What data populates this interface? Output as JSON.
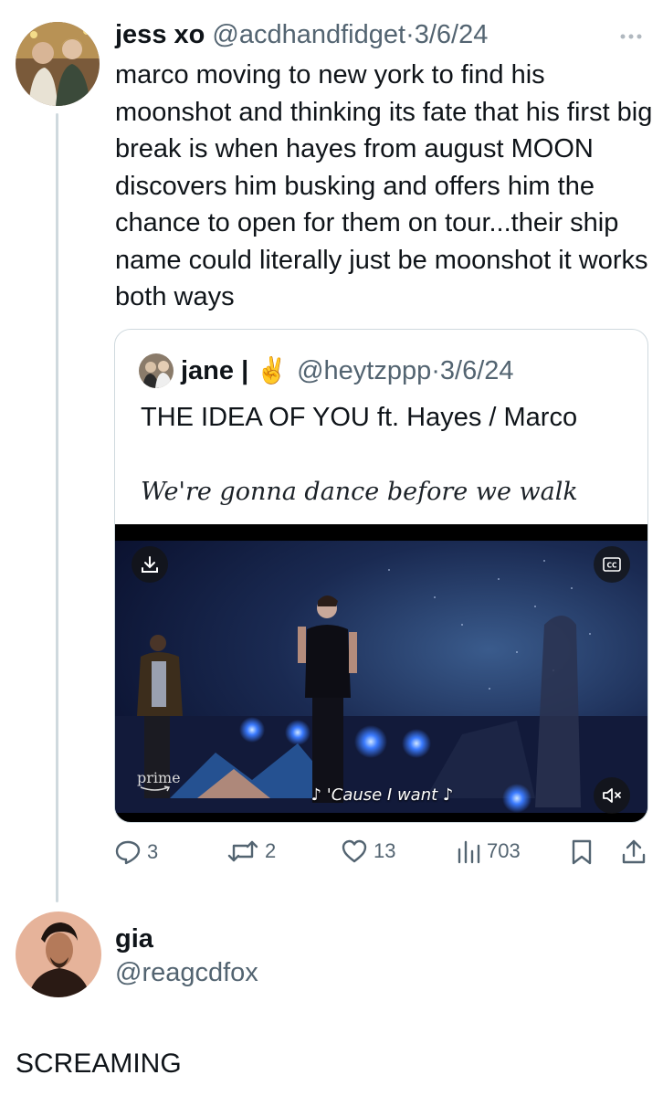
{
  "tweet": {
    "name": "jess xo",
    "handle": "@acdhandfidget",
    "dot": "·",
    "date": "3/6/24",
    "text": "marco moving to new york to find his moonshot and thinking its fate that his first big break is when hayes from august MOON discovers him busking and offers him the chance to open for them on tour...their ship name could literally just be moonshot it works both ways",
    "more_icon": "more-dots-icon"
  },
  "quote": {
    "name": "jane |",
    "emoji": "✌️",
    "handle": "@heytzppp",
    "dot": "·",
    "date": "3/6/24",
    "line1": "THE IDEA OF YOU ft. Hayes / Marco",
    "line2": "We're gonna dance before we walk",
    "video": {
      "subtitle": "♪ 'Cause I want ♪",
      "watermark": "prime"
    }
  },
  "actions": {
    "replies": "3",
    "retweets": "2",
    "likes": "13",
    "views": "703"
  },
  "reply": {
    "name": "gia",
    "handle": "@reagcdfox",
    "text": "SCREAMING"
  },
  "colors": {
    "muted": "#536471",
    "thread_line": "#cfd9de",
    "text": "#0f1419"
  }
}
